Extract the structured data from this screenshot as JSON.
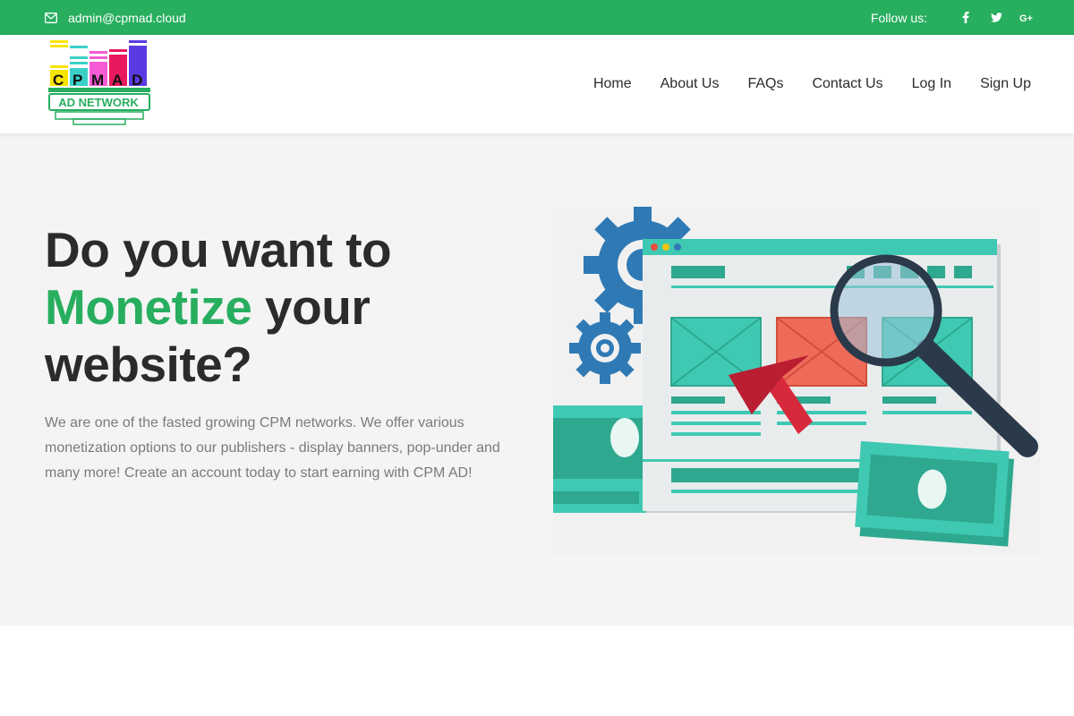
{
  "topbar": {
    "email": "admin@cpmad.cloud",
    "follow_label": "Follow us:",
    "social": [
      {
        "icon": "facebook-icon",
        "glyph": "f"
      },
      {
        "icon": "twitter-icon",
        "glyph": "t"
      },
      {
        "icon": "google-plus-icon",
        "glyph": "G+"
      }
    ]
  },
  "logo": {
    "letters": [
      "C",
      "P",
      "M",
      "A",
      "D"
    ],
    "tagline": "AD NETWORK"
  },
  "nav": {
    "items": [
      {
        "label": "Home"
      },
      {
        "label": "About Us"
      },
      {
        "label": "FAQs"
      },
      {
        "label": "Contact Us"
      },
      {
        "label": "Log In"
      },
      {
        "label": "Sign Up"
      }
    ]
  },
  "hero": {
    "headline_part1": "Do you want to",
    "headline_accent": "Monetize",
    "headline_part2": " your",
    "headline_part3": "website?",
    "description": "We are one of the fasted growing CPM networks. We offer various monetization options to our publishers - display banners, pop-under and many more! Create an account today to start earning with CPM AD!"
  },
  "colors": {
    "brand_green": "#27ae5f",
    "text_dark": "#2b2b2b",
    "text_muted": "#7a7a7a",
    "hero_bg": "#f4f4f4",
    "teal": "#3fc9b3",
    "gear_blue": "#2f7ab5",
    "cursor_red": "#d7283c"
  }
}
